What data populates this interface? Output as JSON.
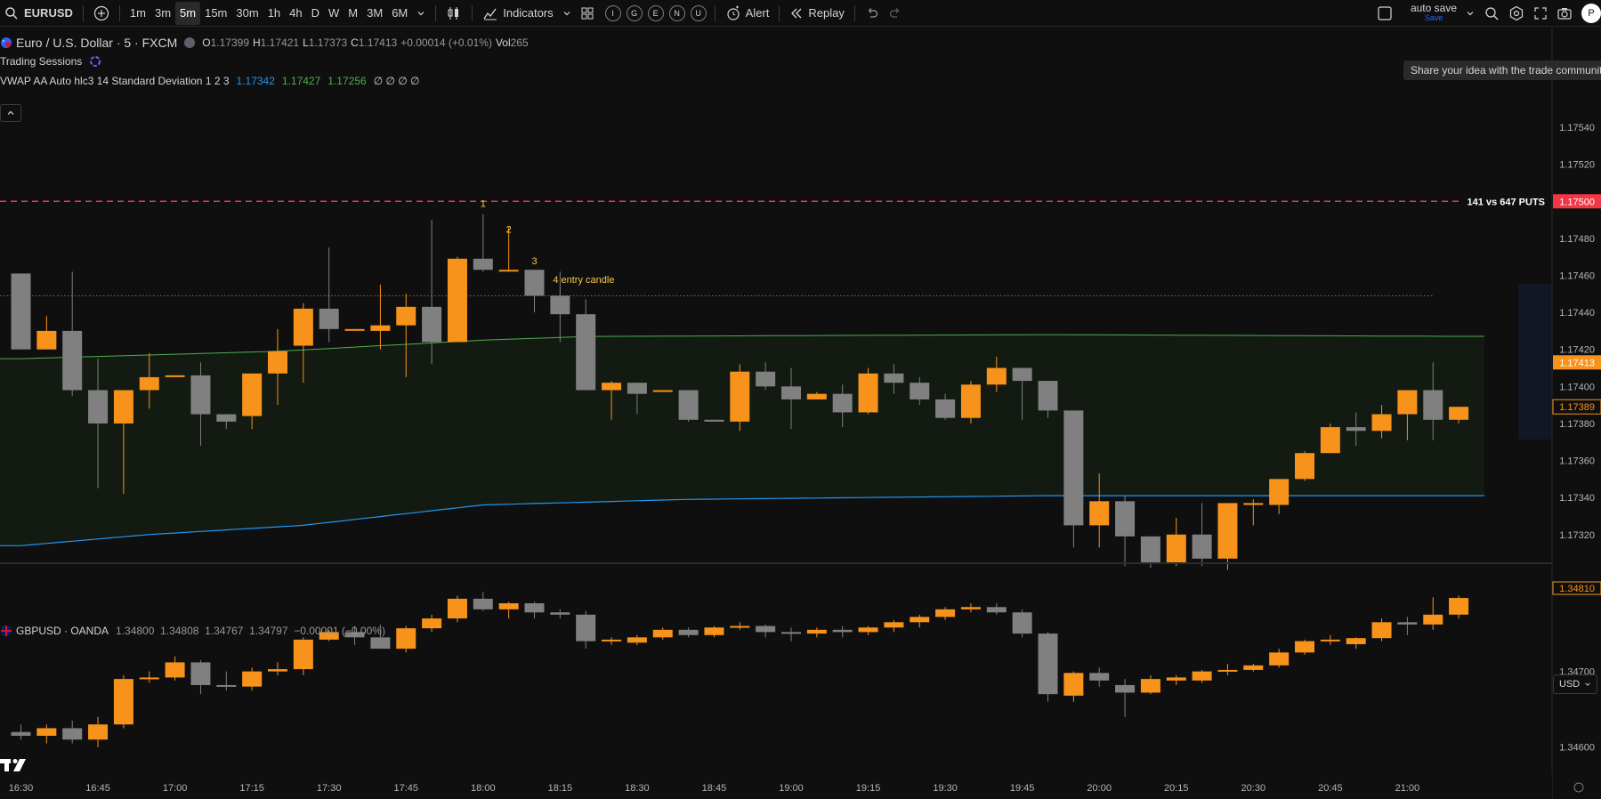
{
  "toolbar": {
    "symbol": "EURUSD",
    "add_symbol_icon": "plus-circle-icon",
    "intervals": [
      "1m",
      "3m",
      "5m",
      "15m",
      "30m",
      "1h",
      "4h",
      "D",
      "W",
      "M",
      "3M",
      "6M"
    ],
    "active_interval": "5m",
    "indicators_label": "Indicators",
    "circle_buttons": [
      "I",
      "G",
      "E",
      "N",
      "U"
    ],
    "alert_label": "Alert",
    "replay_label": "Replay",
    "autosave_label": "auto save",
    "autosave_sub": "Save",
    "profile_initial": "P"
  },
  "tooltip": "Share your idea with the trade community",
  "main_legend": {
    "title": "Euro / U.S. Dollar · 5 · FXCM",
    "open_label": "O",
    "open": "1.17399",
    "high_label": "H",
    "high": "1.17421",
    "low_label": "L",
    "low": "1.17373",
    "close_label": "C",
    "close": "1.17413",
    "change": "+0.00014 (+0.01%)",
    "vol_label": "Vol",
    "vol": "265",
    "trading_sessions": "Trading Sessions",
    "vwap_label": "VWAP AA Auto hlc3 14 Standard Deviation 1 2 3",
    "vwap_v1": "1.17342",
    "vwap_v2": "1.17427",
    "vwap_v3": "1.17256",
    "vwap_rest": "∅ ∅ ∅ ∅"
  },
  "sub_legend": {
    "title": "GBPUSD · OANDA",
    "values": "1.34800  1.34808  1.34767  1.34797  −0.00001 (−0.00%)"
  },
  "currency_selector": "USD",
  "colors": {
    "up": "#f7931a",
    "down": "#808080",
    "vwap": "#4caf50",
    "lower_band": "#2196f3",
    "dashed_line": "#f23645",
    "dotted_line": "#f7931a",
    "background": "#0f0f0f"
  },
  "annotations": {
    "line_label": "141 vs 647 PUTS",
    "line_price": "1.17500",
    "marks": [
      "1",
      "2",
      "3",
      "4 entry candle"
    ]
  },
  "price_axis": {
    "ticks": [
      "1.17540",
      "1.17520",
      "1.17480",
      "1.17460",
      "1.17440",
      "1.17420",
      "1.17400",
      "1.17380",
      "1.17360",
      "1.17340",
      "1.17320"
    ],
    "current_price": "1.17413",
    "cursor_price": "1.17389",
    "sub_ticks": [
      "1.34700",
      "1.34600"
    ],
    "sub_current": "1.34810"
  },
  "time_axis": [
    "16:30",
    "16:45",
    "17:00",
    "17:15",
    "17:30",
    "17:45",
    "18:00",
    "18:15",
    "18:30",
    "18:45",
    "19:00",
    "19:15",
    "19:30",
    "19:45",
    "20:00",
    "20:15",
    "20:30",
    "20:45",
    "21:00"
  ],
  "chart_data": {
    "type": "candlestick",
    "symbol": "EURUSD",
    "interval": "5m",
    "ylim": [
      1.17305,
      1.17565
    ],
    "candles": [
      {
        "o": 1.17461,
        "h": 1.17461,
        "l": 1.1742,
        "c": 1.1742
      },
      {
        "o": 1.1742,
        "h": 1.17438,
        "l": 1.1742,
        "c": 1.1743
      },
      {
        "o": 1.1743,
        "h": 1.17462,
        "l": 1.17395,
        "c": 1.17398
      },
      {
        "o": 1.17398,
        "h": 1.17415,
        "l": 1.17345,
        "c": 1.1738
      },
      {
        "o": 1.1738,
        "h": 1.17396,
        "l": 1.17342,
        "c": 1.17398
      },
      {
        "o": 1.17398,
        "h": 1.17418,
        "l": 1.17388,
        "c": 1.17405
      },
      {
        "o": 1.17406,
        "h": 1.17406,
        "l": 1.17406,
        "c": 1.17406
      },
      {
        "o": 1.17406,
        "h": 1.17413,
        "l": 1.17368,
        "c": 1.17385
      },
      {
        "o": 1.17385,
        "h": 1.17385,
        "l": 1.17377,
        "c": 1.17381
      },
      {
        "o": 1.17384,
        "h": 1.17407,
        "l": 1.17377,
        "c": 1.17407
      },
      {
        "o": 1.17407,
        "h": 1.17431,
        "l": 1.1739,
        "c": 1.17419
      },
      {
        "o": 1.17422,
        "h": 1.17445,
        "l": 1.17402,
        "c": 1.17442
      },
      {
        "o": 1.17442,
        "h": 1.17475,
        "l": 1.17424,
        "c": 1.17431
      },
      {
        "o": 1.17431,
        "h": 1.17431,
        "l": 1.17431,
        "c": 1.17431
      },
      {
        "o": 1.1743,
        "h": 1.17455,
        "l": 1.1742,
        "c": 1.17433
      },
      {
        "o": 1.17433,
        "h": 1.1745,
        "l": 1.17405,
        "c": 1.17443
      },
      {
        "o": 1.17443,
        "h": 1.1749,
        "l": 1.17412,
        "c": 1.17424
      },
      {
        "o": 1.17424,
        "h": 1.1747,
        "l": 1.17424,
        "c": 1.17469
      },
      {
        "o": 1.17469,
        "h": 1.17493,
        "l": 1.17462,
        "c": 1.17463
      },
      {
        "o": 1.17463,
        "h": 1.17486,
        "l": 1.17462,
        "c": 1.17463
      },
      {
        "o": 1.17463,
        "h": 1.17463,
        "l": 1.1744,
        "c": 1.17449
      },
      {
        "o": 1.17449,
        "h": 1.17462,
        "l": 1.17424,
        "c": 1.17439
      },
      {
        "o": 1.17439,
        "h": 1.17447,
        "l": 1.17398,
        "c": 1.17398
      },
      {
        "o": 1.17398,
        "h": 1.17403,
        "l": 1.17382,
        "c": 1.17402
      },
      {
        "o": 1.17402,
        "h": 1.17402,
        "l": 1.17385,
        "c": 1.17396
      },
      {
        "o": 1.17398,
        "h": 1.17398,
        "l": 1.17398,
        "c": 1.17398
      },
      {
        "o": 1.17398,
        "h": 1.17398,
        "l": 1.17381,
        "c": 1.17382
      },
      {
        "o": 1.17382,
        "h": 1.17382,
        "l": 1.17381,
        "c": 1.17381
      },
      {
        "o": 1.17381,
        "h": 1.17412,
        "l": 1.17376,
        "c": 1.17408
      },
      {
        "o": 1.17408,
        "h": 1.17413,
        "l": 1.17398,
        "c": 1.174
      },
      {
        "o": 1.174,
        "h": 1.1741,
        "l": 1.17377,
        "c": 1.17393
      },
      {
        "o": 1.17393,
        "h": 1.17397,
        "l": 1.17393,
        "c": 1.17396
      },
      {
        "o": 1.17396,
        "h": 1.17401,
        "l": 1.17378,
        "c": 1.17386
      },
      {
        "o": 1.17386,
        "h": 1.1741,
        "l": 1.17385,
        "c": 1.17407
      },
      {
        "o": 1.17407,
        "h": 1.17412,
        "l": 1.17396,
        "c": 1.17402
      },
      {
        "o": 1.17402,
        "h": 1.17405,
        "l": 1.1739,
        "c": 1.17393
      },
      {
        "o": 1.17393,
        "h": 1.17396,
        "l": 1.17382,
        "c": 1.17383
      },
      {
        "o": 1.17383,
        "h": 1.17403,
        "l": 1.1738,
        "c": 1.17401
      },
      {
        "o": 1.17401,
        "h": 1.17416,
        "l": 1.17397,
        "c": 1.1741
      },
      {
        "o": 1.1741,
        "h": 1.1741,
        "l": 1.17382,
        "c": 1.17403
      },
      {
        "o": 1.17403,
        "h": 1.17403,
        "l": 1.17383,
        "c": 1.17387
      },
      {
        "o": 1.17387,
        "h": 1.17387,
        "l": 1.17313,
        "c": 1.17325
      },
      {
        "o": 1.17325,
        "h": 1.17353,
        "l": 1.17313,
        "c": 1.17338
      },
      {
        "o": 1.17338,
        "h": 1.17341,
        "l": 1.17303,
        "c": 1.17319
      },
      {
        "o": 1.17319,
        "h": 1.17319,
        "l": 1.17302,
        "c": 1.17305
      },
      {
        "o": 1.17305,
        "h": 1.17329,
        "l": 1.17303,
        "c": 1.1732
      },
      {
        "o": 1.1732,
        "h": 1.17337,
        "l": 1.17303,
        "c": 1.17307
      },
      {
        "o": 1.17307,
        "h": 1.17337,
        "l": 1.17301,
        "c": 1.17337
      },
      {
        "o": 1.17336,
        "h": 1.17339,
        "l": 1.17325,
        "c": 1.17337
      },
      {
        "o": 1.17336,
        "h": 1.1735,
        "l": 1.17331,
        "c": 1.1735
      },
      {
        "o": 1.1735,
        "h": 1.17365,
        "l": 1.17349,
        "c": 1.17364
      },
      {
        "o": 1.17364,
        "h": 1.1738,
        "l": 1.17364,
        "c": 1.17378
      },
      {
        "o": 1.17378,
        "h": 1.17386,
        "l": 1.17368,
        "c": 1.17376
      },
      {
        "o": 1.17376,
        "h": 1.1739,
        "l": 1.17372,
        "c": 1.17385
      },
      {
        "o": 1.17385,
        "h": 1.17398,
        "l": 1.17371,
        "c": 1.17398
      },
      {
        "o": 1.17398,
        "h": 1.17413,
        "l": 1.17371,
        "c": 1.17382
      },
      {
        "o": 1.17382,
        "h": 1.17389,
        "l": 1.1738,
        "c": 1.17389
      }
    ],
    "vwap": [
      {
        "i": 0,
        "v": 1.17415
      },
      {
        "i": 10,
        "v": 1.17419
      },
      {
        "i": 18,
        "v": 1.17425
      },
      {
        "i": 22,
        "v": 1.17427
      },
      {
        "i": 40,
        "v": 1.17428
      },
      {
        "i": 57,
        "v": 1.17427
      }
    ],
    "lower_band": [
      {
        "i": 0,
        "v": 1.17314
      },
      {
        "i": 5,
        "v": 1.1732
      },
      {
        "i": 11,
        "v": 1.17325
      },
      {
        "i": 18,
        "v": 1.17336
      },
      {
        "i": 26,
        "v": 1.17339
      },
      {
        "i": 40,
        "v": 1.17341
      },
      {
        "i": 57,
        "v": 1.17341
      }
    ],
    "horizontal_lines": [
      {
        "price": 1.175,
        "style": "dashed",
        "label": "141 vs 647 PUTS"
      },
      {
        "price": 1.17449,
        "style": "dotted"
      }
    ],
    "gbpusd_candles": [
      {
        "o": 1.3462,
        "h": 1.3463,
        "l": 1.3461,
        "c": 1.34615
      },
      {
        "o": 1.34615,
        "h": 1.3463,
        "l": 1.34605,
        "c": 1.34625
      },
      {
        "o": 1.34625,
        "h": 1.34635,
        "l": 1.34605,
        "c": 1.3461
      },
      {
        "o": 1.3461,
        "h": 1.3464,
        "l": 1.346,
        "c": 1.3463
      },
      {
        "o": 1.3463,
        "h": 1.34695,
        "l": 1.34625,
        "c": 1.3469
      },
      {
        "o": 1.3469,
        "h": 1.347,
        "l": 1.34685,
        "c": 1.34692
      },
      {
        "o": 1.34692,
        "h": 1.3472,
        "l": 1.34688,
        "c": 1.34712
      },
      {
        "o": 1.34712,
        "h": 1.34715,
        "l": 1.3467,
        "c": 1.34682
      },
      {
        "o": 1.34682,
        "h": 1.347,
        "l": 1.34675,
        "c": 1.3468
      },
      {
        "o": 1.3468,
        "h": 1.34705,
        "l": 1.34675,
        "c": 1.347
      },
      {
        "o": 1.347,
        "h": 1.34712,
        "l": 1.34695,
        "c": 1.34703
      },
      {
        "o": 1.34703,
        "h": 1.34745,
        "l": 1.34695,
        "c": 1.34742
      },
      {
        "o": 1.34742,
        "h": 1.34755,
        "l": 1.3474,
        "c": 1.34752
      },
      {
        "o": 1.34752,
        "h": 1.3476,
        "l": 1.34735,
        "c": 1.34745
      },
      {
        "o": 1.34745,
        "h": 1.34762,
        "l": 1.34735,
        "c": 1.3473
      },
      {
        "o": 1.3473,
        "h": 1.3476,
        "l": 1.34725,
        "c": 1.34757
      },
      {
        "o": 1.34757,
        "h": 1.34775,
        "l": 1.34752,
        "c": 1.3477
      },
      {
        "o": 1.3477,
        "h": 1.348,
        "l": 1.34765,
        "c": 1.34796
      },
      {
        "o": 1.34796,
        "h": 1.34805,
        "l": 1.3478,
        "c": 1.34782
      },
      {
        "o": 1.34782,
        "h": 1.34792,
        "l": 1.3477,
        "c": 1.3479
      },
      {
        "o": 1.3479,
        "h": 1.34792,
        "l": 1.3477,
        "c": 1.34778
      },
      {
        "o": 1.34778,
        "h": 1.34782,
        "l": 1.3477,
        "c": 1.34775
      },
      {
        "o": 1.34775,
        "h": 1.3478,
        "l": 1.3473,
        "c": 1.3474
      },
      {
        "o": 1.3474,
        "h": 1.34745,
        "l": 1.34735,
        "c": 1.34742
      },
      {
        "o": 1.34738,
        "h": 1.34748,
        "l": 1.34735,
        "c": 1.34745
      },
      {
        "o": 1.34745,
        "h": 1.34758,
        "l": 1.34742,
        "c": 1.34755
      },
      {
        "o": 1.34755,
        "h": 1.34758,
        "l": 1.34745,
        "c": 1.34748
      },
      {
        "o": 1.34748,
        "h": 1.3476,
        "l": 1.34745,
        "c": 1.34758
      },
      {
        "o": 1.34758,
        "h": 1.34765,
        "l": 1.34755,
        "c": 1.3476
      },
      {
        "o": 1.3476,
        "h": 1.34762,
        "l": 1.34745,
        "c": 1.34752
      },
      {
        "o": 1.34752,
        "h": 1.34758,
        "l": 1.3474,
        "c": 1.3475
      },
      {
        "o": 1.3475,
        "h": 1.34758,
        "l": 1.34745,
        "c": 1.34755
      },
      {
        "o": 1.34755,
        "h": 1.3476,
        "l": 1.34745,
        "c": 1.34752
      },
      {
        "o": 1.34752,
        "h": 1.3476,
        "l": 1.34748,
        "c": 1.34758
      },
      {
        "o": 1.34758,
        "h": 1.34768,
        "l": 1.34752,
        "c": 1.34765
      },
      {
        "o": 1.34765,
        "h": 1.34775,
        "l": 1.34758,
        "c": 1.34772
      },
      {
        "o": 1.34772,
        "h": 1.34785,
        "l": 1.34768,
        "c": 1.34782
      },
      {
        "o": 1.34782,
        "h": 1.3479,
        "l": 1.34778,
        "c": 1.34785
      },
      {
        "o": 1.34785,
        "h": 1.3479,
        "l": 1.34775,
        "c": 1.34778
      },
      {
        "o": 1.34778,
        "h": 1.34782,
        "l": 1.34745,
        "c": 1.3475
      },
      {
        "o": 1.3475,
        "h": 1.34752,
        "l": 1.3466,
        "c": 1.3467
      },
      {
        "o": 1.34668,
        "h": 1.347,
        "l": 1.3466,
        "c": 1.34698
      },
      {
        "o": 1.34698,
        "h": 1.34705,
        "l": 1.3468,
        "c": 1.34688
      },
      {
        "o": 1.34682,
        "h": 1.3469,
        "l": 1.3464,
        "c": 1.34672
      },
      {
        "o": 1.34672,
        "h": 1.34695,
        "l": 1.3467,
        "c": 1.3469
      },
      {
        "o": 1.34688,
        "h": 1.34695,
        "l": 1.34682,
        "c": 1.34692
      },
      {
        "o": 1.34688,
        "h": 1.34702,
        "l": 1.34685,
        "c": 1.347
      },
      {
        "o": 1.347,
        "h": 1.3471,
        "l": 1.34695,
        "c": 1.34702
      },
      {
        "o": 1.34702,
        "h": 1.3471,
        "l": 1.347,
        "c": 1.34708
      },
      {
        "o": 1.34708,
        "h": 1.3473,
        "l": 1.34705,
        "c": 1.34725
      },
      {
        "o": 1.34725,
        "h": 1.34742,
        "l": 1.34722,
        "c": 1.3474
      },
      {
        "o": 1.3474,
        "h": 1.34748,
        "l": 1.34735,
        "c": 1.34742
      },
      {
        "o": 1.34736,
        "h": 1.34745,
        "l": 1.3473,
        "c": 1.34744
      },
      {
        "o": 1.34744,
        "h": 1.3477,
        "l": 1.3474,
        "c": 1.34765
      },
      {
        "o": 1.34765,
        "h": 1.34772,
        "l": 1.34748,
        "c": 1.34762
      },
      {
        "o": 1.34762,
        "h": 1.34798,
        "l": 1.34755,
        "c": 1.34775
      },
      {
        "o": 1.34775,
        "h": 1.348,
        "l": 1.3477,
        "c": 1.34797
      }
    ],
    "sub_ylim": [
      1.34575,
      1.3483
    ]
  }
}
